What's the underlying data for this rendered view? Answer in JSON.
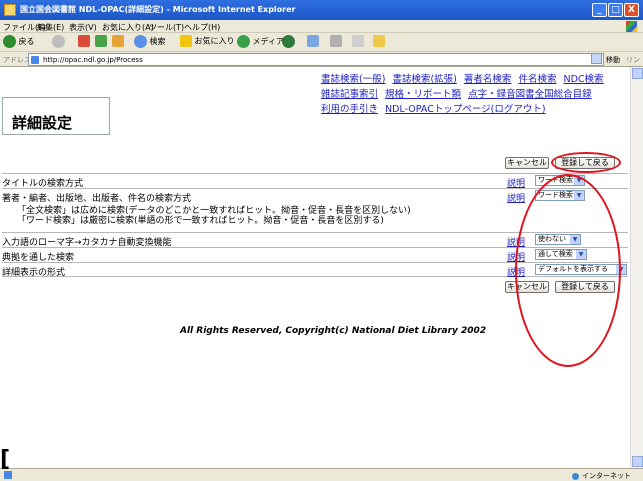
{
  "window": {
    "title": "国立国会図書館 NDL-OPAC(詳細設定) - Microsoft Internet Explorer",
    "min_label": "_",
    "max_label": "□",
    "close_label": "X"
  },
  "menubar": {
    "items": [
      "ファイル(F)",
      "編集(E)",
      "表示(V)",
      "お気に入り(A)",
      "ツール(T)",
      "ヘルプ(H)"
    ]
  },
  "toolbar": {
    "back_label": "戻る",
    "search_label": "検索",
    "favorites_label": "お気に入り",
    "media_label": "メディア"
  },
  "address": {
    "label": "アドレス(D)",
    "url": "http://opac.ndl.go.jp/Process",
    "go_label": "移動",
    "links_label": "リンク"
  },
  "page": {
    "title": "詳細設定",
    "nav_links": [
      [
        "書誌検索(一般)",
        "書誌検索(拡張)",
        "著者名検索",
        "件名検索",
        "NDC検索"
      ],
      [
        "雑誌記事索引",
        "規格・リポート類",
        "点字・録音図書全国総合目録"
      ],
      [
        "利用の手引き",
        "NDL-OPACトップページ(ログアウト)"
      ]
    ],
    "cancel_label": "キャンセル",
    "save_back_label": "登録して戻る",
    "help_label": "説明",
    "settings": [
      {
        "label": "タイトルの検索方式",
        "value": "ワード検索"
      },
      {
        "label": "著者・編者、出版地、出版者、件名の検索方式",
        "value": "ワード検索"
      },
      {
        "label": "入力語のローマ字→カタカナ自動変換機能",
        "value": "使わない"
      },
      {
        "label": "典拠を通した検索",
        "value": "通して検索"
      },
      {
        "label": "詳細表示の形式",
        "value": "デフォルトを表示する"
      }
    ],
    "notes": [
      "「全文検索」は広めに検索(データのどこかと一致すればヒット。拗音・促音・長音を区別しない)",
      "「ワード検索」は厳密に検索(単語の形で一致すればヒット。拗音・促音・長音を区別する)"
    ],
    "copyright": "All Rights Reserved, Copyright(c) National Diet Library 2002"
  },
  "status": {
    "zone": "インターネット",
    "left_bracket": "["
  },
  "colors": {
    "title_bar": "#1d56c7",
    "link": "#1f1fbf",
    "annotation": "#e0141e",
    "chrome": "#ece9d8"
  }
}
